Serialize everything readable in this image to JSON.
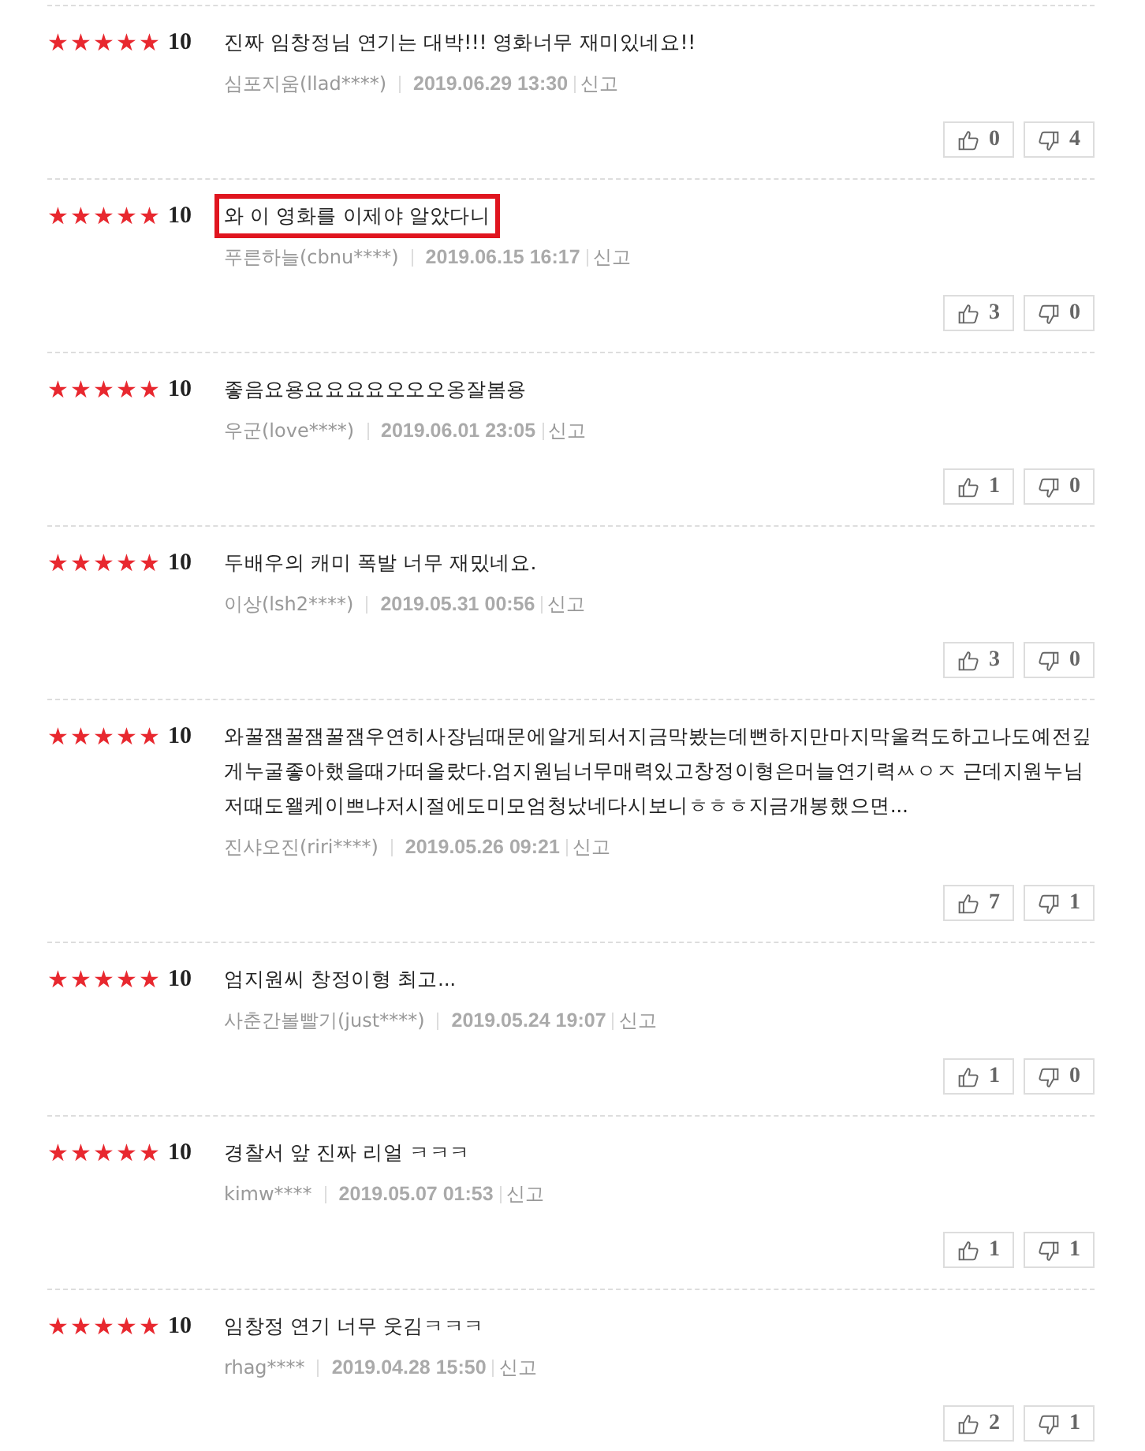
{
  "reviews": [
    {
      "stars": 5,
      "score": "10",
      "text": "진짜 임창정님 연기는 대박!!! 영화너무 재미있네요!!",
      "author": "심포지움(llad****)",
      "date": "2019.06.29 13:30",
      "report": "신고",
      "likes": "0",
      "dislikes": "4",
      "highlighted": false
    },
    {
      "stars": 5,
      "score": "10",
      "text": "와 이 영화를 이제야 알았다니",
      "author": "푸른하늘(cbnu****)",
      "date": "2019.06.15 16:17",
      "report": "신고",
      "likes": "3",
      "dislikes": "0",
      "highlighted": true
    },
    {
      "stars": 5,
      "score": "10",
      "text": "좋음요용요요요요오오오옹잘봄용",
      "author": "우군(love****)",
      "date": "2019.06.01 23:05",
      "report": "신고",
      "likes": "1",
      "dislikes": "0",
      "highlighted": false
    },
    {
      "stars": 5,
      "score": "10",
      "text": "두배우의 캐미 폭발 너무 재밌네요.",
      "author": "이상(lsh2****)",
      "date": "2019.05.31 00:56",
      "report": "신고",
      "likes": "3",
      "dislikes": "0",
      "highlighted": false
    },
    {
      "stars": 5,
      "score": "10",
      "text": "와꿀잼꿀잼꿀잼우연히사장님때문에알게되서지금막봤는데뻔하지만마지막울컥도하고나도예전깊게누굴좋아했을때가떠올랐다.엄지원님너무매력있고창정이형은머늘연기력ㅆㅇㅈ 근데지원누님저때도왤케이쁘냐저시절에도미모엄청났네다시보니ㅎㅎㅎ지금개봉했으면...",
      "author": "진샤오진(riri****)",
      "date": "2019.05.26 09:21",
      "report": "신고",
      "likes": "7",
      "dislikes": "1",
      "highlighted": false
    },
    {
      "stars": 5,
      "score": "10",
      "text": "엄지원씨 창정이형 최고...",
      "author": "사춘간볼빨기(just****)",
      "date": "2019.05.24 19:07",
      "report": "신고",
      "likes": "1",
      "dislikes": "0",
      "highlighted": false
    },
    {
      "stars": 5,
      "score": "10",
      "text": "경찰서 앞 진짜 리얼 ㅋㅋㅋ",
      "author": "kimw****",
      "date": "2019.05.07 01:53",
      "report": "신고",
      "likes": "1",
      "dislikes": "1",
      "highlighted": false
    },
    {
      "stars": 5,
      "score": "10",
      "text": "임창정 연기 너무 웃김ㅋㅋㅋ",
      "author": "rhag****",
      "date": "2019.04.28 15:50",
      "report": "신고",
      "likes": "2",
      "dislikes": "1",
      "highlighted": false
    }
  ]
}
